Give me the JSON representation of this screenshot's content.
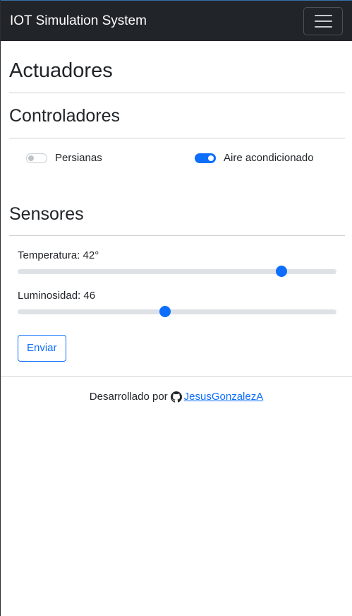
{
  "navbar": {
    "brand": "IOT Simulation System"
  },
  "page": {
    "title": "Actuadores"
  },
  "controllers": {
    "heading": "Controladores",
    "items": [
      {
        "label": "Persianas",
        "on": false
      },
      {
        "label": "Aire acondicionado",
        "on": true
      }
    ]
  },
  "sensors": {
    "heading": "Sensores",
    "temperature": {
      "label": "Temperatura: 42°",
      "value": 42,
      "min": 0,
      "max": 50
    },
    "luminosity": {
      "label": "Luminosidad: 46",
      "value": 46,
      "min": 0,
      "max": 100
    }
  },
  "actions": {
    "submit_label": "Enviar"
  },
  "footer": {
    "text": "Desarrollado por",
    "link_text": "JesusGonzalezA"
  },
  "colors": {
    "primary": "#0d6efd",
    "navbar": "#212529"
  },
  "icons": {
    "menu": "hamburger-icon",
    "github": "github-icon"
  }
}
